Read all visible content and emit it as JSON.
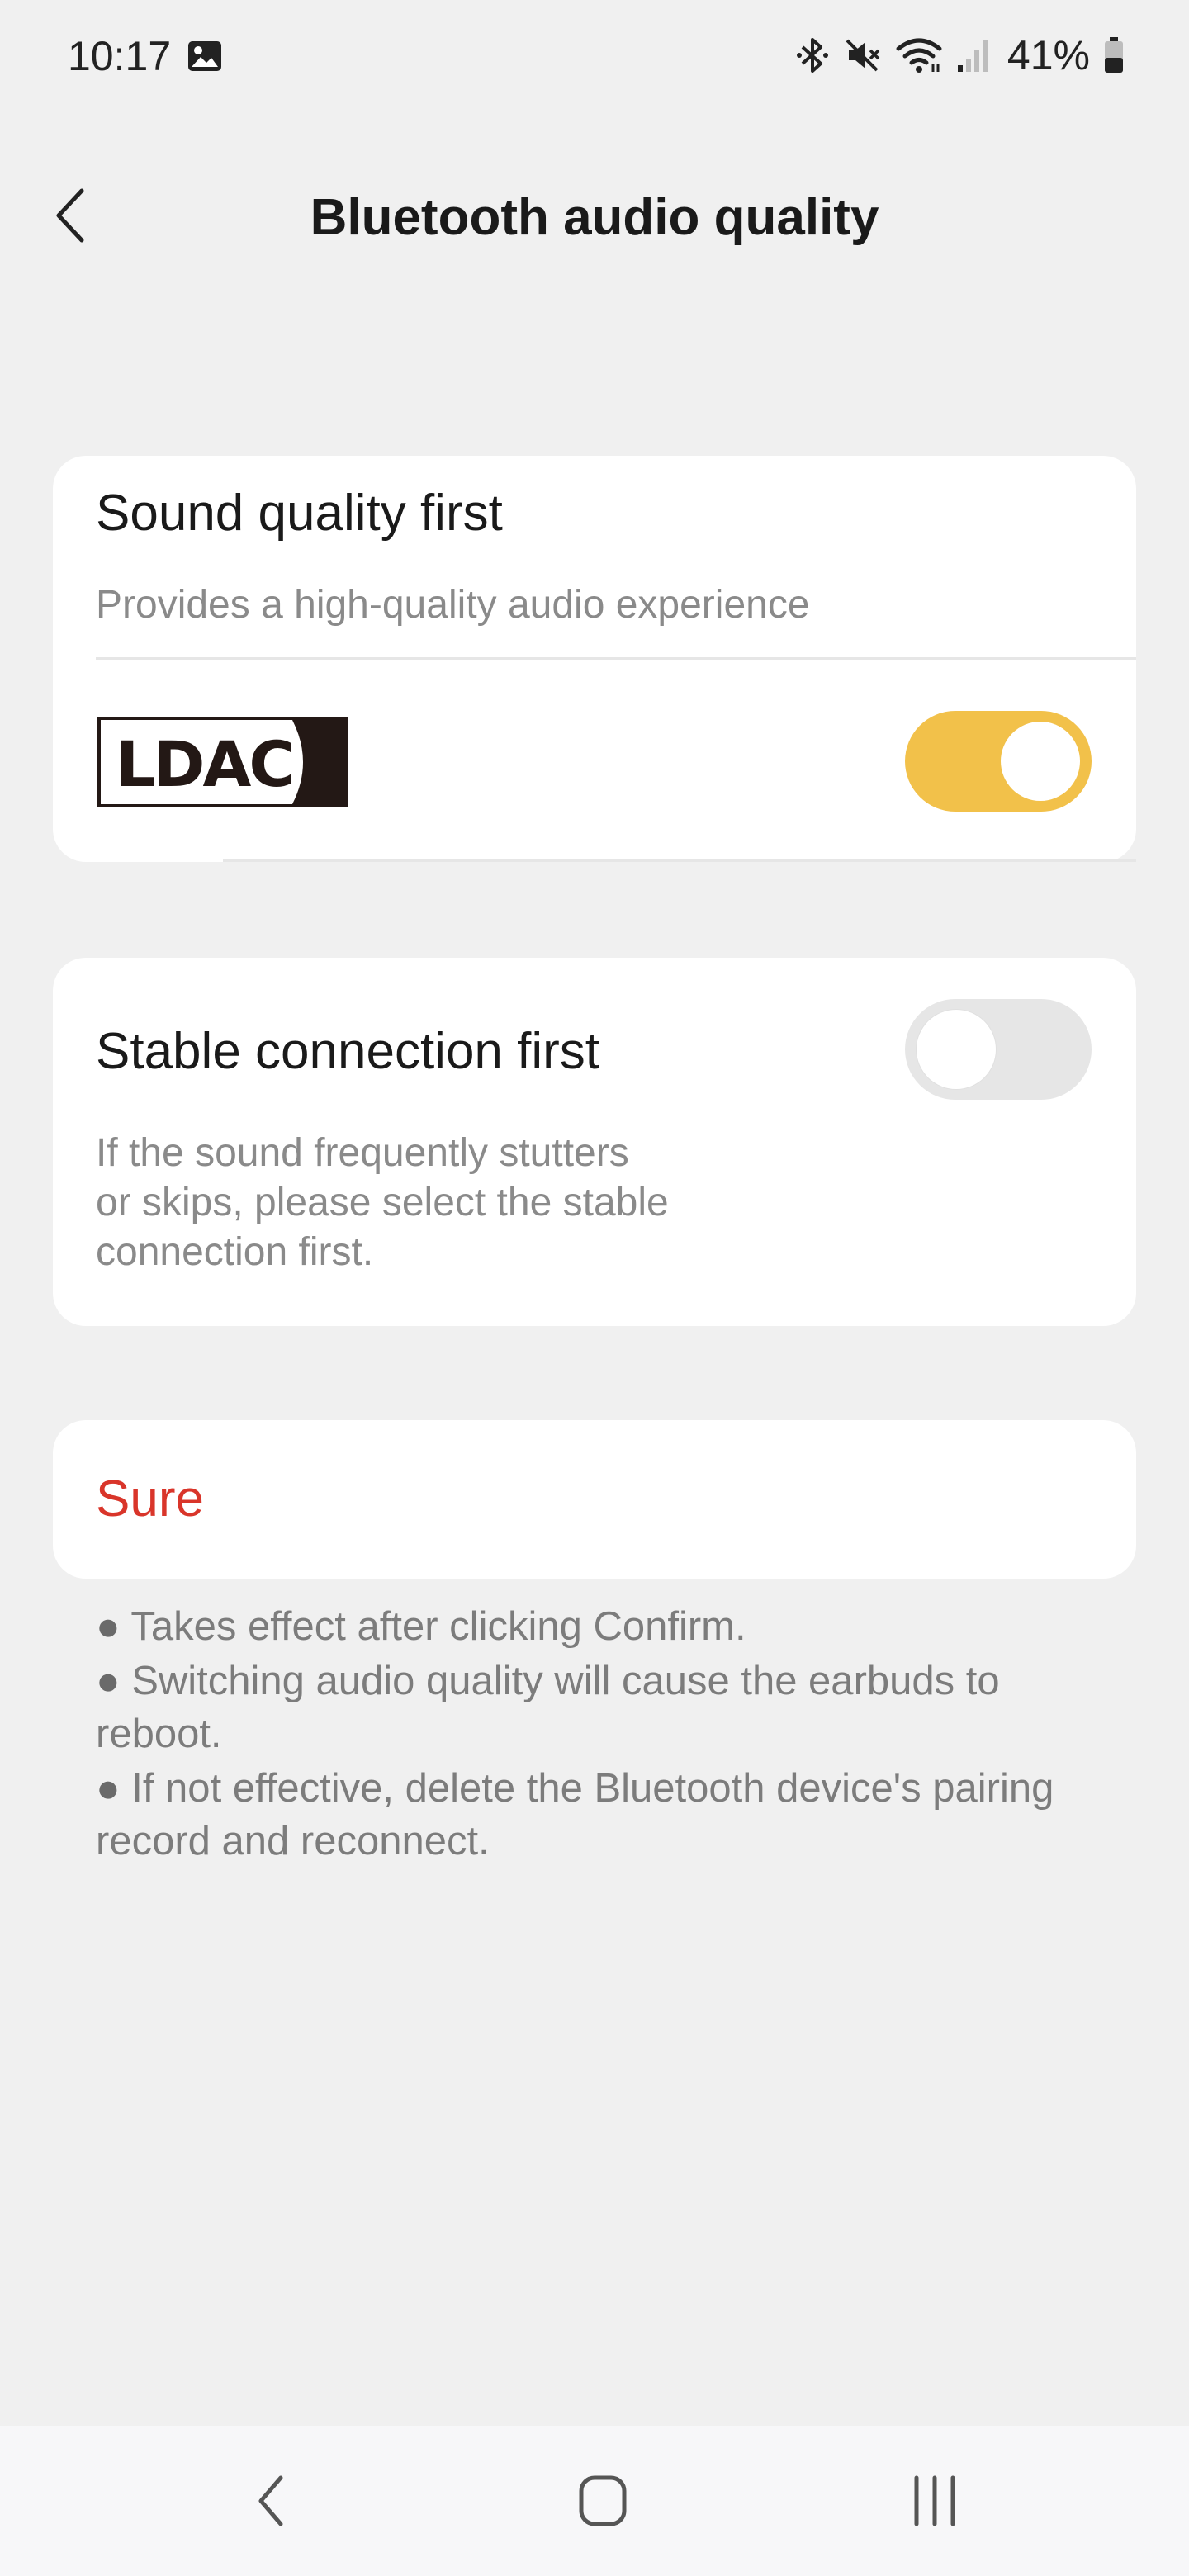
{
  "status_bar": {
    "time": "10:17",
    "battery": "41%",
    "icons": [
      "gallery-icon",
      "bluetooth-icon",
      "mute-icon",
      "wifi-icon",
      "signal-icon",
      "battery-icon"
    ]
  },
  "header": {
    "title": "Bluetooth audio quality",
    "back_icon": "chevron-left-icon"
  },
  "sound_quality": {
    "title": "Sound quality first",
    "description": "Provides a high-quality audio experience",
    "logo_text": "LDAC",
    "toggle_on": true,
    "toggle_color": "#f2c14a"
  },
  "stable_connection": {
    "title": "Stable connection first",
    "description_lines": [
      "If the sound frequently stutters",
      "or skips, please select the stable",
      "connection first."
    ],
    "toggle_on": false
  },
  "confirm": {
    "label": "Sure",
    "color": "#d9352a"
  },
  "notes": [
    "Takes effect after clicking Confirm.",
    "Switching audio quality will cause the earbuds to reboot.",
    "If not effective, delete the Bluetooth device's pairing record and reconnect."
  ],
  "nav_bar": {
    "icons": [
      "nav-back-icon",
      "nav-home-icon",
      "nav-recents-icon"
    ]
  }
}
